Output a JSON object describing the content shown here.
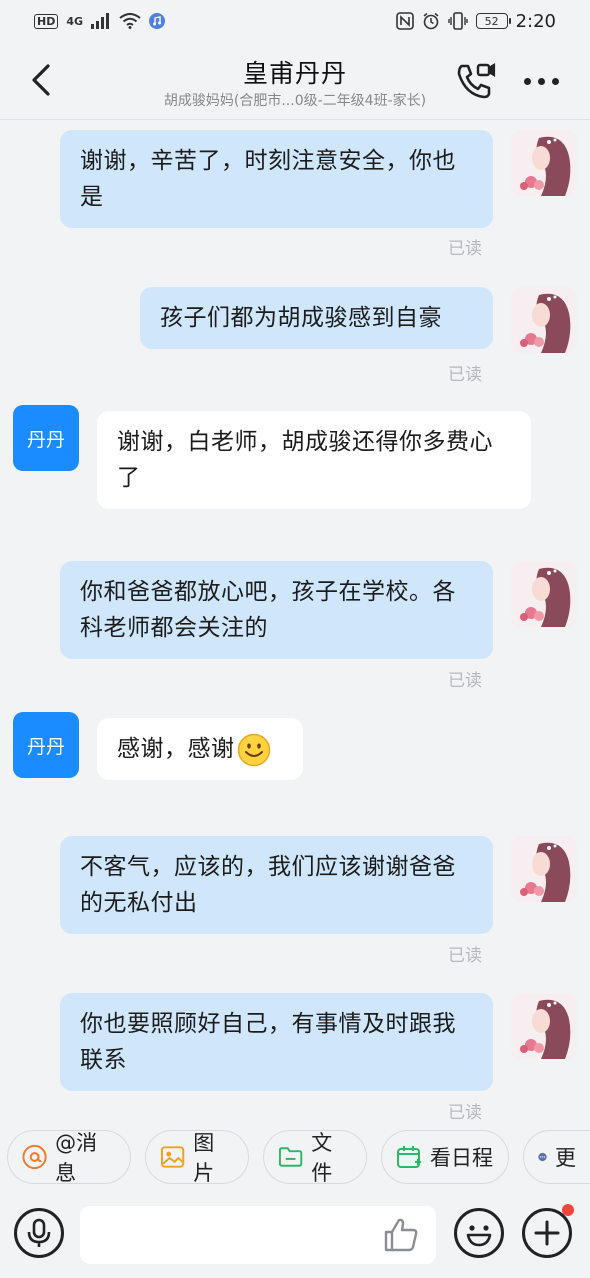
{
  "status_bar": {
    "hd": "HD",
    "network": "4G",
    "battery": "52",
    "time": "2:20"
  },
  "header": {
    "title": "皇甫丹丹",
    "subtitle": "胡成骏妈妈(合肥市...0级-二年级4班-家长)"
  },
  "messages": [
    {
      "side": "out",
      "text": "谢谢，辛苦了，时刻注意安全，你也是",
      "status": "已读"
    },
    {
      "side": "out",
      "text": "孩子们都为胡成骏感到自豪",
      "status": "已读"
    },
    {
      "side": "in",
      "avatar_text": "丹丹",
      "text": "谢谢，白老师，胡成骏还得你多费心了"
    },
    {
      "side": "out",
      "text": "你和爸爸都放心吧，孩子在学校。各科老师都会关注的",
      "status": "已读"
    },
    {
      "side": "in",
      "avatar_text": "丹丹",
      "text": "感谢，感谢",
      "emoji": "smile-emoji"
    },
    {
      "side": "out",
      "text": "不客气，应该的，我们应该谢谢爸爸的无私付出",
      "status": "已读"
    },
    {
      "side": "out",
      "text": "你也要照顾好自己，有事情及时跟我联系",
      "status": "已读"
    }
  ],
  "quick_actions": [
    {
      "label": "@消息",
      "icon": "at-icon",
      "color": "#f07a2a"
    },
    {
      "label": "图片",
      "icon": "image-icon",
      "color": "#f0a020"
    },
    {
      "label": "文件",
      "icon": "folder-icon",
      "color": "#2cb865"
    },
    {
      "label": "看日程",
      "icon": "calendar-icon",
      "color": "#2cb865"
    },
    {
      "label": "更",
      "icon": "more-dots-icon",
      "color": "#5a72b0"
    }
  ],
  "input": {
    "placeholder": ""
  },
  "colors": {
    "bubble_out": "#cfe6fb",
    "bubble_in": "#ffffff",
    "avatar_in": "#1a8cff",
    "read_status": "#b5b8bd",
    "notification_dot": "#f0443c"
  }
}
